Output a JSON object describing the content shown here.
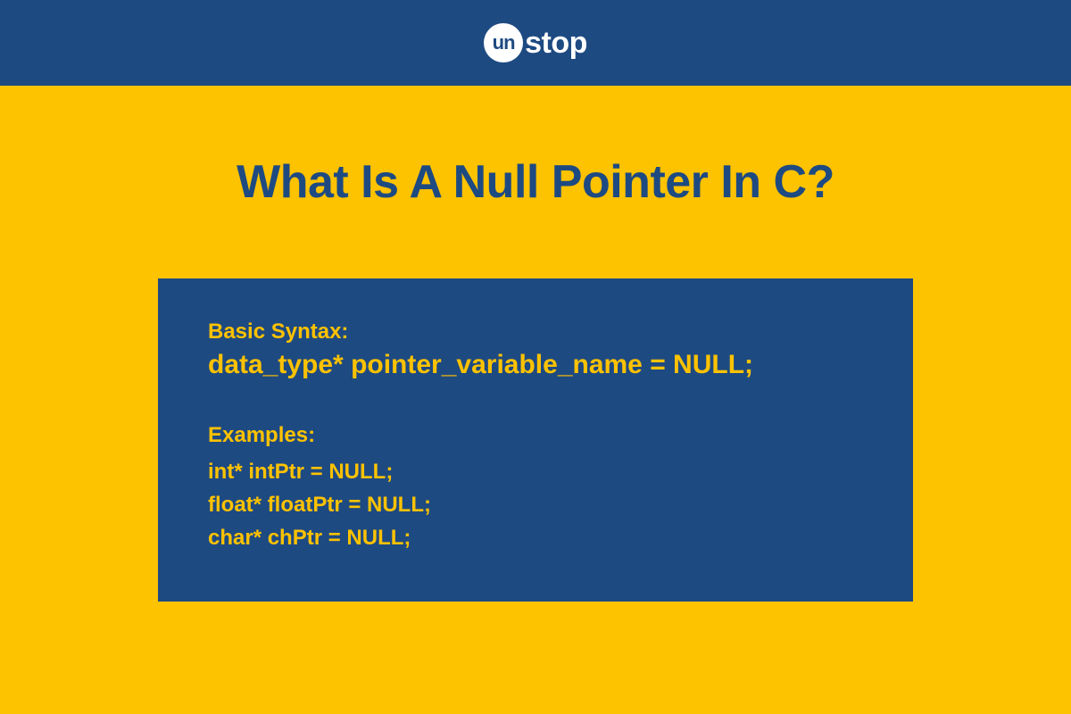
{
  "brand": {
    "circle_text": "un",
    "rest_text": "stop"
  },
  "title": "What Is A Null Pointer In C?",
  "code_box": {
    "syntax_label": "Basic Syntax:",
    "syntax_line": "data_type* pointer_variable_name = NULL;",
    "examples_label": "Examples:",
    "examples": [
      "int* intPtr = NULL;",
      "float* floatPtr = NULL;",
      "char* chPtr = NULL;"
    ]
  },
  "colors": {
    "navy": "#1e4a82",
    "yellow": "#fdc200",
    "white": "#ffffff"
  }
}
